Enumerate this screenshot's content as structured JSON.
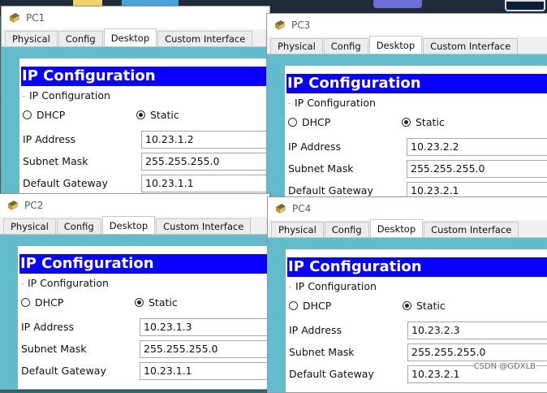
{
  "tabs": [
    "Physical",
    "Config",
    "Desktop",
    "Custom Interface"
  ],
  "active_tab": "Desktop",
  "header_title": "IP Configuration",
  "group_label": "IP Configuration",
  "dhcp_label": "DHCP",
  "static_label": "Static",
  "selected_mode": "Static",
  "field_labels": {
    "ip": "IP Address",
    "mask": "Subnet Mask",
    "gateway": "Default Gateway"
  },
  "windows": [
    {
      "title": "PC1",
      "ip": "10.23.1.2",
      "mask": "255.255.255.0",
      "gateway": "10.23.1.1"
    },
    {
      "title": "PC3",
      "ip": "10.23.2.2",
      "mask": "255.255.255.0",
      "gateway": "10.23.2.1"
    },
    {
      "title": "PC2",
      "ip": "10.23.1.3",
      "mask": "255.255.255.0",
      "gateway": "10.23.1.1"
    },
    {
      "title": "PC4",
      "ip": "10.23.2.3",
      "mask": "255.255.255.0",
      "gateway": "10.23.2.1"
    }
  ],
  "colors": {
    "header_bg": "#0a00ff",
    "content_bg": "#62bccb",
    "active_tab_bg": "#ffffff"
  },
  "watermark": "CSDN @GDXLB"
}
